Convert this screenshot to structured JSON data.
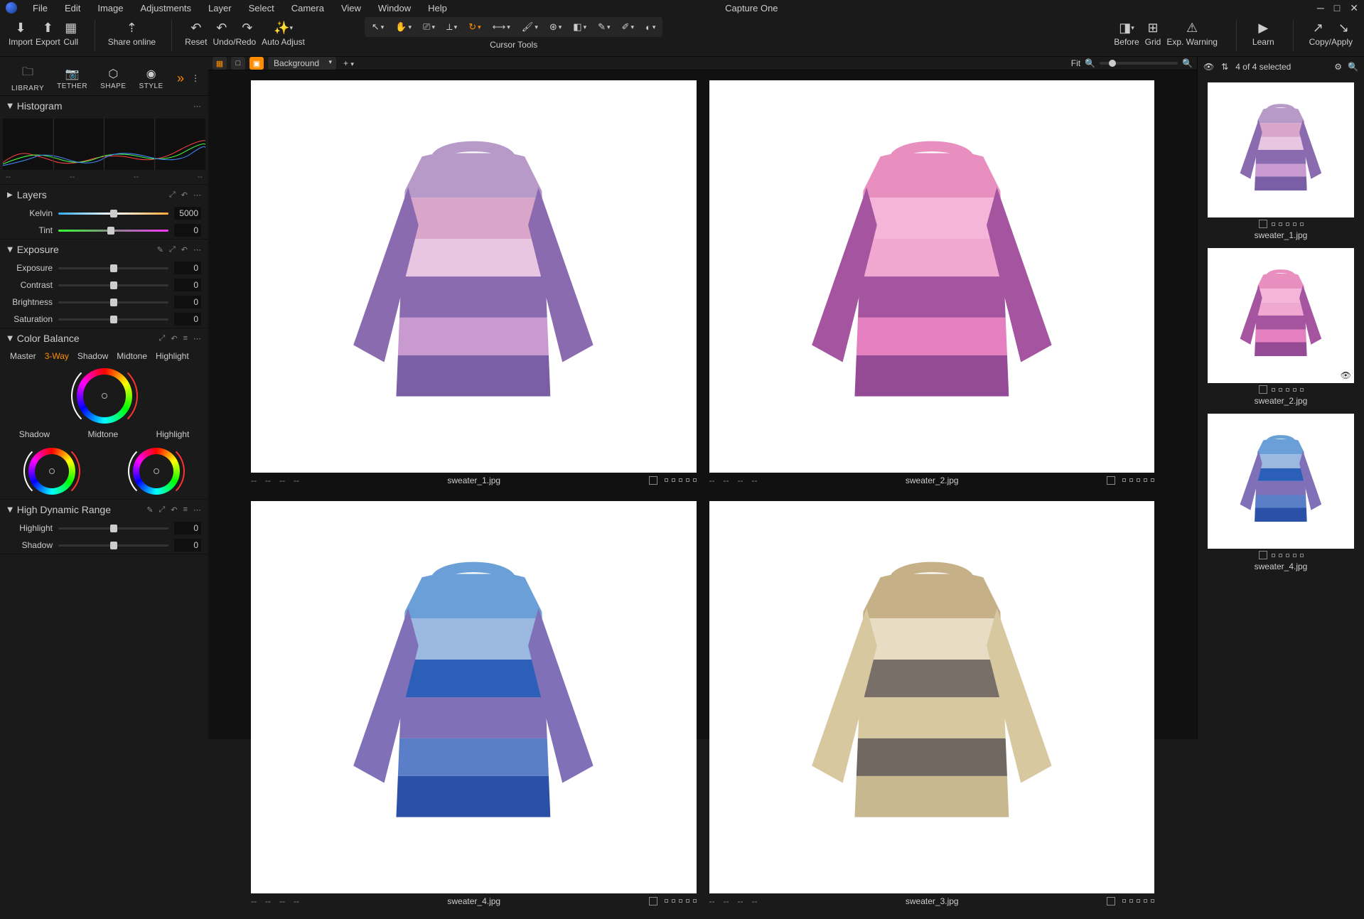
{
  "menu": {
    "items": [
      "File",
      "Edit",
      "Image",
      "Adjustments",
      "Layer",
      "Select",
      "Camera",
      "View",
      "Window",
      "Help"
    ],
    "app_title": "Capture One"
  },
  "toolbar": {
    "import": "Import",
    "export": "Export",
    "cull": "Cull",
    "share": "Share online",
    "reset": "Reset",
    "undo_redo": "Undo/Redo",
    "auto_adjust": "Auto Adjust",
    "cursor_tools": "Cursor Tools",
    "before": "Before",
    "grid": "Grid",
    "exp_warning": "Exp. Warning",
    "learn": "Learn",
    "copy_apply": "Copy/Apply"
  },
  "left_tabs": [
    "LIBRARY",
    "TETHER",
    "SHAPE",
    "STYLE"
  ],
  "panels": {
    "histogram": "Histogram",
    "layers": "Layers",
    "exposure": "Exposure",
    "color_balance": "Color Balance",
    "hdr": "High Dynamic Range"
  },
  "sliders": {
    "kelvin": {
      "label": "Kelvin",
      "value": "5000",
      "pos": 50
    },
    "tint": {
      "label": "Tint",
      "value": "0",
      "pos": 48
    },
    "exposure": {
      "label": "Exposure",
      "value": "0",
      "pos": 50
    },
    "contrast": {
      "label": "Contrast",
      "value": "0",
      "pos": 50
    },
    "brightness": {
      "label": "Brightness",
      "value": "0",
      "pos": 50
    },
    "saturation": {
      "label": "Saturation",
      "value": "0",
      "pos": 50
    },
    "highlight": {
      "label": "Highlight",
      "value": "0",
      "pos": 50
    },
    "shadow": {
      "label": "Shadow",
      "value": "0",
      "pos": 50
    }
  },
  "color_balance": {
    "tabs": [
      "Master",
      "3-Way",
      "Shadow",
      "Midtone",
      "Highlight"
    ],
    "active_tab": "3-Way",
    "wheel_labels": {
      "shadow": "Shadow",
      "midtone": "Midtone",
      "highlight": "Highlight"
    }
  },
  "viewer": {
    "layer_dropdown": "Background",
    "fit": "Fit",
    "images": [
      {
        "filename": "sweater_1.jpg",
        "selected": false
      },
      {
        "filename": "sweater_2.jpg",
        "selected": false
      },
      {
        "filename": "sweater_4.jpg",
        "selected": true
      },
      {
        "filename": "sweater_3.jpg",
        "selected": false
      }
    ]
  },
  "filmstrip": {
    "selection": "4 of 4 selected",
    "items": [
      {
        "filename": "sweater_1.jpg"
      },
      {
        "filename": "sweater_2.jpg"
      },
      {
        "filename": "sweater_4.jpg"
      }
    ]
  },
  "sweater_palettes": {
    "sweater_1": [
      "#b89ac9",
      "#d9a5c9",
      "#e8c5e0",
      "#8a6bb0",
      "#c89ad0",
      "#7a5fa6"
    ],
    "sweater_2": [
      "#e88fc0",
      "#f4b5d8",
      "#f0a8d0",
      "#a555a0",
      "#e47fc0",
      "#954a95"
    ],
    "sweater_3": [
      "#c5b088",
      "#e8dcc5",
      "#787068",
      "#d8c8a0",
      "#706860",
      "#c8b890"
    ],
    "sweater_4": [
      "#6a9fd8",
      "#9ab8e0",
      "#2c5fb8",
      "#8070b8",
      "#5a7fc8",
      "#2a50a8"
    ]
  }
}
